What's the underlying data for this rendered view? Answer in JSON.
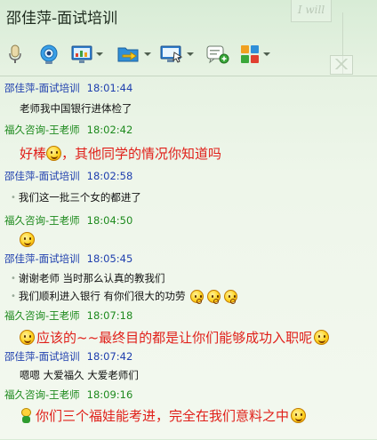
{
  "window": {
    "title": "邵佳萍-面试培训",
    "deco_tag": "I will"
  },
  "toolbar": {
    "icons": [
      "microphone-icon",
      "video-camera-icon",
      "share-screen-icon",
      "file-transfer-icon",
      "remote-assist-icon",
      "add-chat-icon",
      "apps-icon"
    ]
  },
  "colors": {
    "blue_sender": "#1f3fae",
    "green_sender": "#1e8a1e",
    "red_emphasis": "#e0201a"
  },
  "messages": [
    {
      "sender": "邵佳萍-面试培训",
      "time": "18:01:44",
      "lines": [
        "老师我中国银行进体检了"
      ]
    },
    {
      "sender": "福久咨询-王老师",
      "time": "18:02:42",
      "big": "好棒",
      "big_rest": "，其他同学的情况你知道吗"
    },
    {
      "sender": "邵佳萍-面试培训",
      "time": "18:02:58",
      "lines": [
        "我们这一批三个女的都进了"
      ]
    },
    {
      "sender": "福久咨询-王老师",
      "time": "18:04:50"
    },
    {
      "sender": "邵佳萍-面试培训",
      "time": "18:05:45",
      "lines": [
        "谢谢老师 当时那么认真的教我们",
        "我们顺利进入银行 有你们很大的功劳"
      ]
    },
    {
      "sender": "福久咨询-王老师",
      "time": "18:07:18",
      "big": "应该的~~最终目的都是让你们能够成功入职呢"
    },
    {
      "sender": "邵佳萍-面试培训",
      "time": "18:07:42",
      "lines": [
        "嗯嗯 大爱福久 大爱老师们"
      ]
    },
    {
      "sender": "福久咨询-王老师",
      "time": "18:09:16",
      "big": "你们三个福娃能考进，完全在我们意料之中"
    }
  ]
}
